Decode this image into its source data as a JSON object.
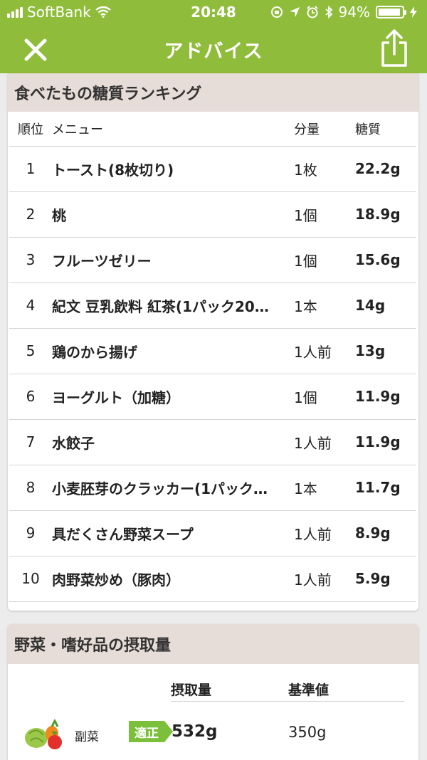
{
  "status": {
    "carrier": "SoftBank",
    "time": "20:48",
    "battery": "94%",
    "battery_level": 0.94
  },
  "nav": {
    "title": "アドバイス",
    "close_icon": "close-icon",
    "share_icon": "share-icon"
  },
  "ranking": {
    "title": "食べたもの糖質ランキング",
    "headers": {
      "rank": "順位",
      "menu": "メニュー",
      "amount": "分量",
      "carbs": "糖質"
    },
    "rows": [
      {
        "rank": "1",
        "name": "トースト(8枚切り)",
        "amount": "1枚",
        "carbs": "22.2g"
      },
      {
        "rank": "2",
        "name": "桃",
        "amount": "1個",
        "carbs": "18.9g"
      },
      {
        "rank": "3",
        "name": "フルーツゼリー",
        "amount": "1個",
        "carbs": "15.6g"
      },
      {
        "rank": "4",
        "name": "紀文 豆乳飲料 紅茶(1パック20…",
        "amount": "1本",
        "carbs": "14g"
      },
      {
        "rank": "5",
        "name": "鶏のから揚げ",
        "amount": "1人前",
        "carbs": "13g"
      },
      {
        "rank": "6",
        "name": "ヨーグルト（加糖）",
        "amount": "1個",
        "carbs": "11.9g"
      },
      {
        "rank": "7",
        "name": "水餃子",
        "amount": "1人前",
        "carbs": "11.9g"
      },
      {
        "rank": "8",
        "name": "小麦胚芽のクラッカー(1パック…",
        "amount": "1本",
        "carbs": "11.7g"
      },
      {
        "rank": "9",
        "name": "具だくさん野菜スープ",
        "amount": "1人前",
        "carbs": "8.9g"
      },
      {
        "rank": "10",
        "name": "肉野菜炒め（豚肉）",
        "amount": "1人前",
        "carbs": "5.9g"
      }
    ]
  },
  "intake": {
    "title": "野菜・嗜好品の摂取量",
    "headers": {
      "intake": "摂取量",
      "standard": "基準値"
    },
    "rows": [
      {
        "label": "副菜",
        "badge": "適正",
        "intake": "532g",
        "standard": "350g",
        "icon": "vegetables-icon",
        "badge_color": "#7bbf3a"
      }
    ]
  },
  "colors": {
    "header": "#8fbd3b",
    "section_head": "#e6dcd8",
    "badge": "#7bbf3a"
  }
}
